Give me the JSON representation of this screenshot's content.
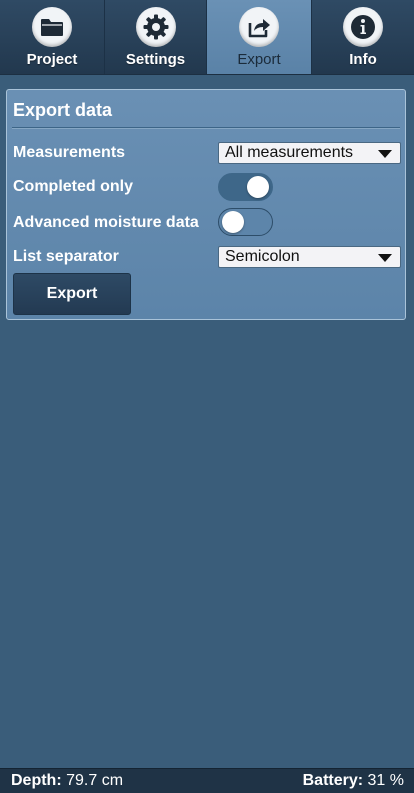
{
  "tabs": [
    {
      "label": "Project",
      "icon": "folder-icon",
      "active": false
    },
    {
      "label": "Settings",
      "icon": "gear-icon",
      "active": false
    },
    {
      "label": "Export",
      "icon": "share-export-icon",
      "active": true
    },
    {
      "label": "Info",
      "icon": "info-icon",
      "active": false
    }
  ],
  "panel": {
    "title": "Export data",
    "measurements": {
      "label": "Measurements",
      "value": "All measurements"
    },
    "completed_only": {
      "label": "Completed only",
      "on": true
    },
    "advanced_moisture": {
      "label": "Advanced moisture data",
      "on": false
    },
    "list_separator": {
      "label": "List separator",
      "value": "Semicolon"
    },
    "export_button": "Export"
  },
  "status": {
    "depth_label": "Depth:",
    "depth_value": "79.7 cm",
    "battery_label": "Battery:",
    "battery_value": "31 %"
  },
  "colors": {
    "background": "#3a5d7a",
    "panel": "#6a90b4",
    "active_tab": "#6a91b5",
    "tabbar": "#27415a",
    "statusbar": "#1f3346",
    "toggle_on": "#3e6789"
  }
}
